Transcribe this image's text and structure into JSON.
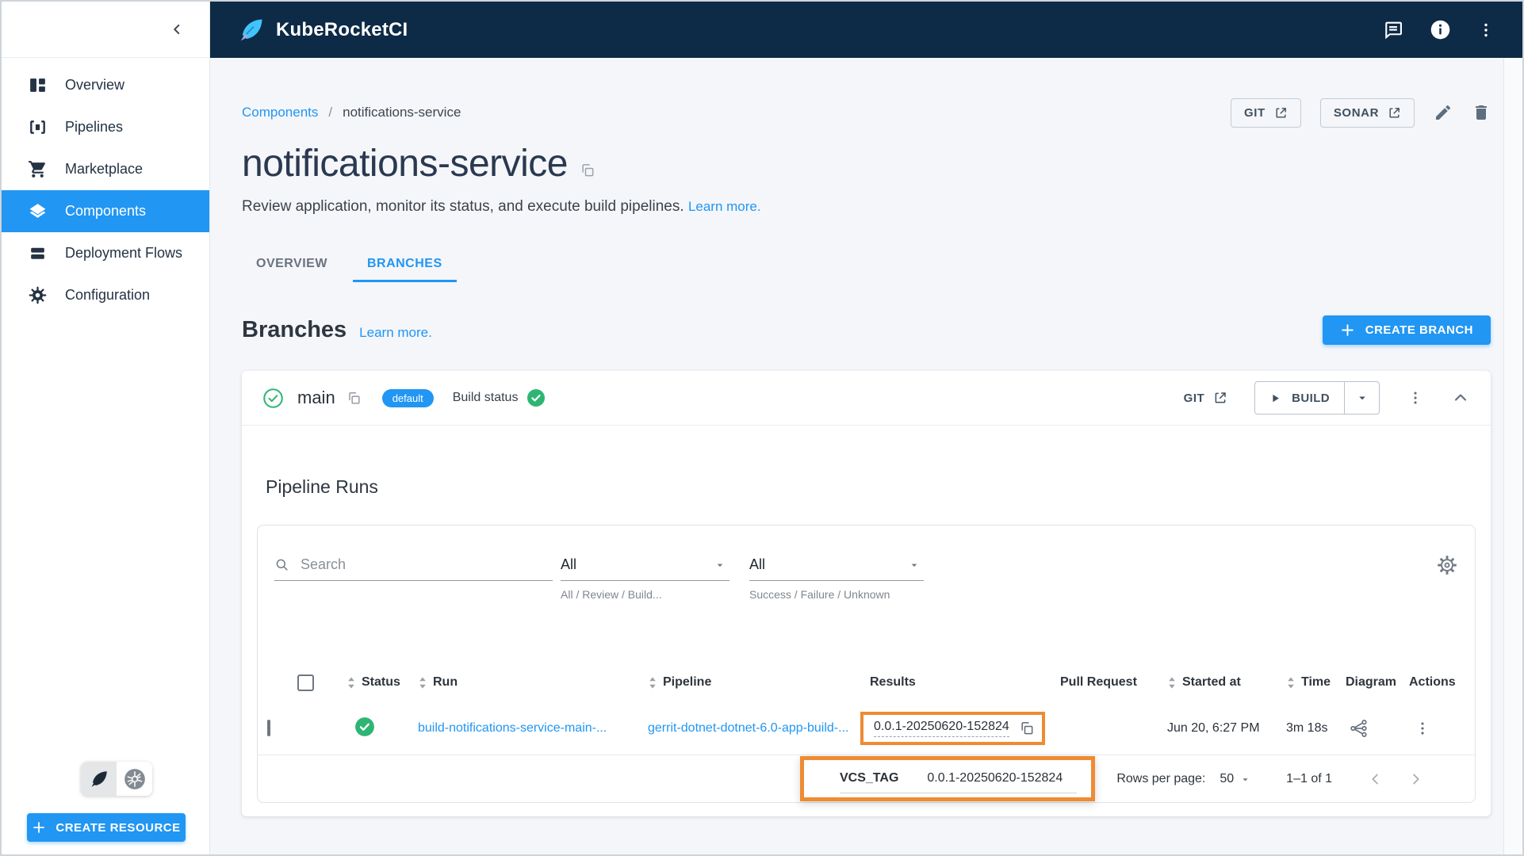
{
  "colors": {
    "header_navy": "#0d2a46",
    "accent_blue": "#2196f3",
    "success_green": "#2eb574",
    "annotation_orange": "#ee8b33"
  },
  "header": {
    "app_title": "KubeRocketCI"
  },
  "sidebar": {
    "items": [
      {
        "label": "Overview"
      },
      {
        "label": "Pipelines"
      },
      {
        "label": "Marketplace"
      },
      {
        "label": "Components"
      },
      {
        "label": "Deployment Flows"
      },
      {
        "label": "Configuration"
      }
    ],
    "create_resource_label": "CREATE RESOURCE"
  },
  "page": {
    "breadcrumb_root": "Components",
    "breadcrumb_separator": "/",
    "breadcrumb_current": "notifications-service",
    "title": "notifications-service",
    "description": "Review application, monitor its status, and execute build pipelines.",
    "learn_more": "Learn more.",
    "git_button": "GIT",
    "sonar_button": "SONAR",
    "tabs": [
      {
        "label": "OVERVIEW"
      },
      {
        "label": "BRANCHES"
      }
    ]
  },
  "branches": {
    "heading": "Branches",
    "learn_more": "Learn more.",
    "create_branch_button": "CREATE BRANCH",
    "branch": {
      "name": "main",
      "default_badge": "default",
      "build_status_label": "Build status",
      "git_button": "GIT",
      "build_button": "BUILD"
    }
  },
  "pipeline_runs": {
    "heading": "Pipeline Runs",
    "search_placeholder": "Search",
    "filters": [
      {
        "value": "All",
        "helper": "All / Review / Build..."
      },
      {
        "value": "All",
        "helper": "Success / Failure / Unknown"
      }
    ],
    "table": {
      "columns": [
        "Status",
        "Run",
        "Pipeline",
        "Results",
        "Pull Request",
        "Started at",
        "Time",
        "Diagram",
        "Actions"
      ],
      "rows": [
        {
          "status": "success",
          "run": "build-notifications-service-main-...",
          "pipeline": "gerrit-dotnet-dotnet-6.0-app-build-...",
          "results": "0.0.1-20250620-152824",
          "pull_request": "",
          "started_at": "Jun 20, 6:27 PM",
          "time": "3m 18s"
        }
      ]
    },
    "result_tooltip": {
      "key": "VCS_TAG",
      "value": "0.0.1-20250620-152824"
    },
    "pagination": {
      "rows_per_page_label": "Rows per page:",
      "rows_per_page_value": "50",
      "range_label": "1–1 of 1"
    }
  }
}
